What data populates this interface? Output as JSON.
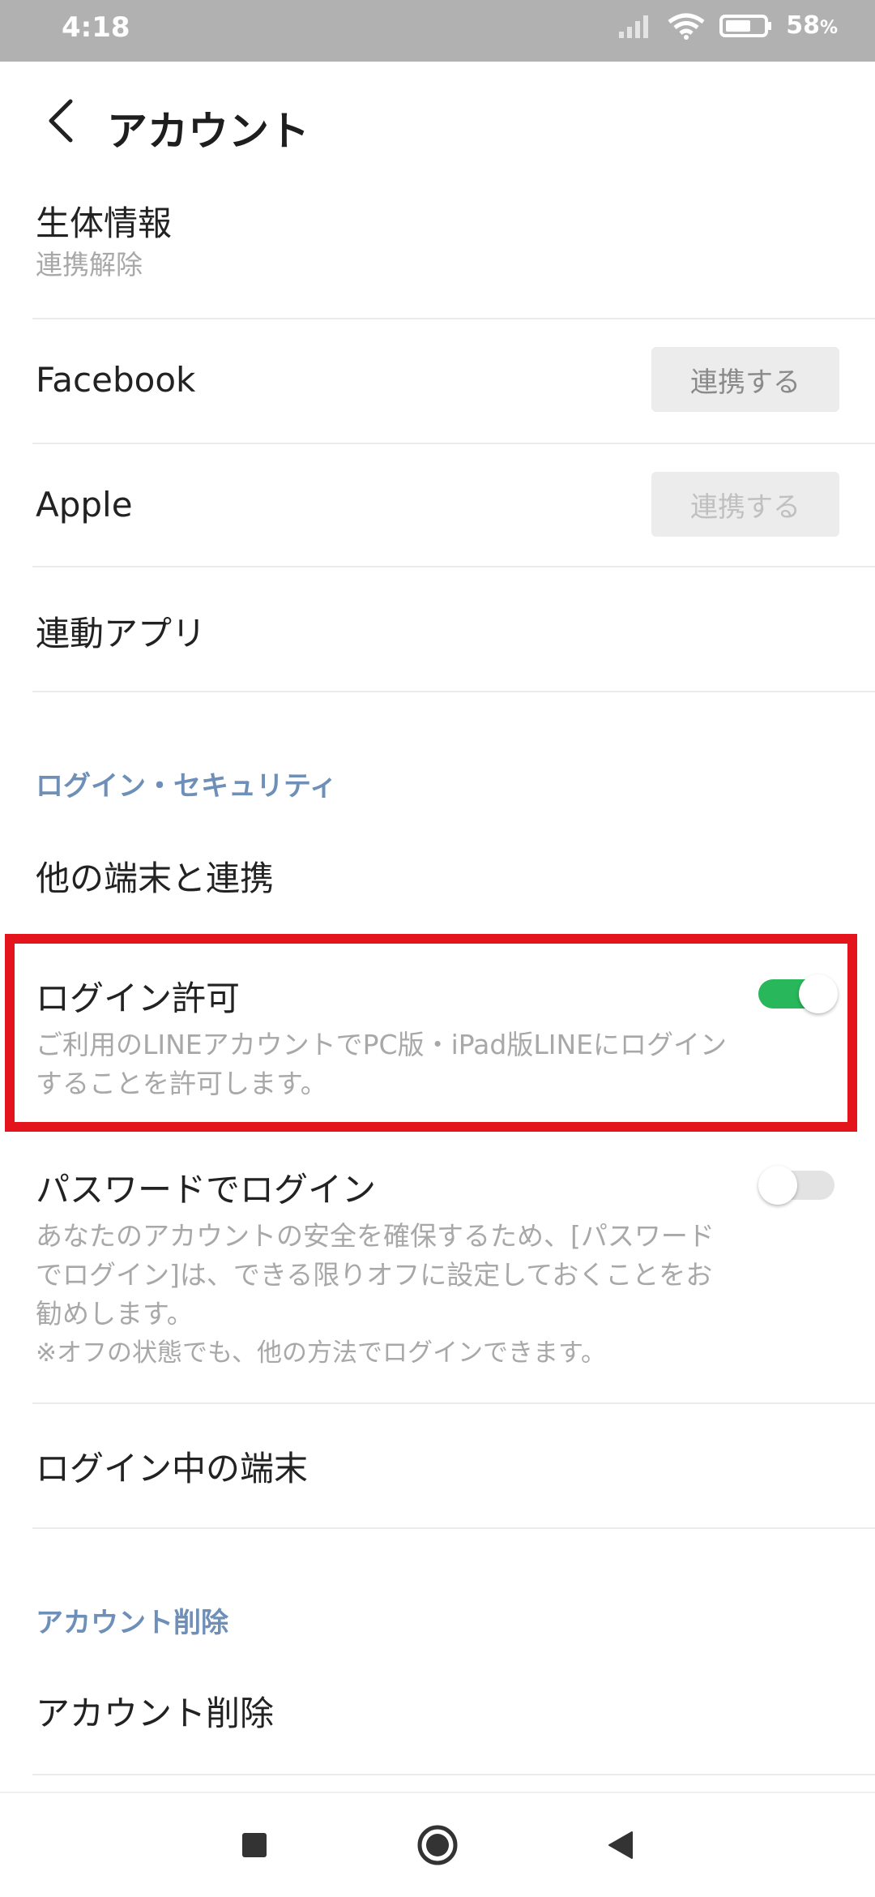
{
  "status_bar": {
    "time": "4:18",
    "battery": "58",
    "battery_unit": "%"
  },
  "header": {
    "title": "アカウント"
  },
  "rows": {
    "biometrics": {
      "label": "生体情報",
      "sub": "連携解除"
    },
    "facebook": {
      "label": "Facebook",
      "button": "連携する"
    },
    "apple": {
      "label": "Apple",
      "button": "連携する"
    },
    "linked_apps": {
      "label": "連動アプリ"
    }
  },
  "section_login": {
    "title": "ログイン・セキュリティ",
    "other_devices": "他の端末と連携",
    "login_permission": {
      "label": "ログイン許可",
      "desc_line1": "ご利用のLINEアカウントでPC版・iPad版LINEにログイン",
      "desc_line2": "することを許可します。",
      "enabled": true
    },
    "password_login": {
      "label": "パスワードでログイン",
      "desc_line1": "あなたのアカウントの安全を確保するため、[パスワード",
      "desc_line2": "でログイン]は、できる限りオフに設定しておくことをお",
      "desc_line3": "勧めします。",
      "desc_line4": "※オフの状態でも、他の方法でログインできます。",
      "enabled": false
    },
    "logged_in_devices": "ログイン中の端末"
  },
  "section_delete": {
    "title": "アカウント削除",
    "delete": "アカウント削除"
  },
  "colors": {
    "accent_green": "#28b75a",
    "section_blue": "#6e8fb7",
    "highlight_red": "#e3141c"
  },
  "icons": [
    "back-icon",
    "wifi-icon",
    "signal-icon",
    "battery-icon",
    "recent-apps-icon",
    "home-icon",
    "back-nav-icon"
  ]
}
